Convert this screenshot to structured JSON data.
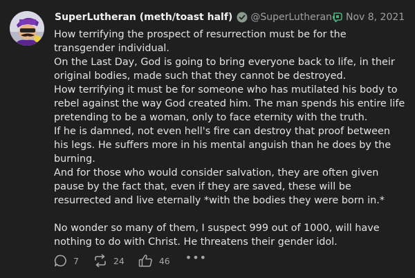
{
  "author": {
    "display_name": "SuperLutheran (meth/toast half)",
    "handle": "@SuperLutheran",
    "verified_icon": "verified-check-icon",
    "avatar_icon": "avatar"
  },
  "meta": {
    "platform_icon": "platform-logo-icon",
    "timestamp": "Nov 8, 2021"
  },
  "post": {
    "paragraphs": [
      "How terrifying the prospect of resurrection must be for the transgender individual.",
      "On the Last Day, God is going to bring everyone back to life, in their original bodies, made such that they cannot be destroyed.",
      "How terrifying it must be for someone who has mutilated his body to rebel against the way God created him. The man spends his entire life pretending to be a woman, only to face eternity with the truth.",
      "If he is damned, not even hell's fire can destroy that proof between his legs. He suffers more in his mental anguish than he does by the burning.",
      "And for those who would consider salvation, they are often given pause by the fact that, even if they are saved, these will be resurrected and live eternally *with the bodies they were born in.*",
      "No wonder so many of them, I suspect 999 out of 1000, will have nothing to do with Christ. He threatens their gender idol."
    ]
  },
  "actions": {
    "replies": "7",
    "reposts": "24",
    "likes": "46",
    "more": "•••"
  },
  "colors": {
    "background": "#1f1f1f",
    "text": "#e4e4e4",
    "muted": "#a0a0a0",
    "verified": "#8a9a8e",
    "platform": "#4caf7a"
  }
}
